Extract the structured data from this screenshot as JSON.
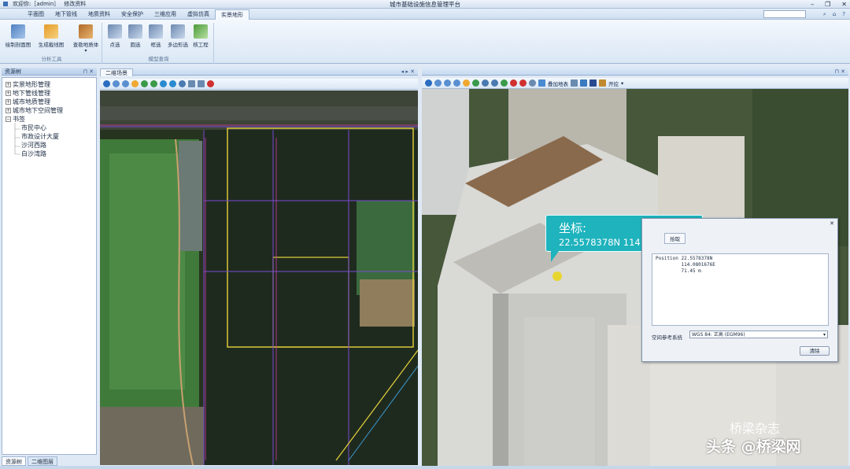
{
  "window": {
    "welcome": "欢迎你:［admin］",
    "switch_label": "修改资料",
    "title": "城市基础设施信息管理平台"
  },
  "ribbon": {
    "tabs": [
      "平面图",
      "地下管线",
      "地质资料",
      "安全保护",
      "三维应用",
      "虚拟仿真",
      "实景地形"
    ],
    "active_tab": "实景地形",
    "groups": [
      {
        "label": "分析工具",
        "buttons": [
          "绘制剖面图",
          "生成截线图",
          "查勘地质体"
        ]
      },
      {
        "label": "模型查询",
        "buttons": [
          "点选",
          "圆选",
          "框选",
          "多边形选",
          "核工程"
        ]
      }
    ]
  },
  "left_panel": {
    "title": "资源树",
    "tree": [
      {
        "label": "实景地形管理",
        "level": 0,
        "expandable": true
      },
      {
        "label": "地下管线管理",
        "level": 0,
        "expandable": true
      },
      {
        "label": "城市地质管理",
        "level": 0,
        "expandable": true
      },
      {
        "label": "城市地下空间管理",
        "level": 0,
        "expandable": true
      },
      {
        "label": "书签",
        "level": 0,
        "expandable": true,
        "expanded": true
      },
      {
        "label": "市民中心",
        "level": 1
      },
      {
        "label": "市政设计大厦",
        "level": 1
      },
      {
        "label": "沙河西路",
        "level": 1
      },
      {
        "label": "白沙湾路",
        "level": 1
      }
    ],
    "bottom_tabs": [
      "资源树",
      "二维图层"
    ],
    "active_bottom_tab": "资源树"
  },
  "map2d": {
    "tab_label": "二维场景"
  },
  "map3d": {
    "toolbar_overlay_label": "叠加地表",
    "toolbar_open_label": "开挖",
    "callout": {
      "label": "坐标:",
      "value": "22.5578378N  114.0802402E"
    },
    "dialog": {
      "tab_label": "拾取",
      "lines": [
        "Position 22.5578378N",
        "         114.0801676E",
        "         71.45 m"
      ],
      "srs_label": "空间参考系统",
      "srs_value": "WGS 84: 正高 (EGM96)",
      "clear_label": "清除"
    }
  },
  "watermark": {
    "line1": "桥梁杂志",
    "line2": "头条 @桥梁网"
  },
  "colors": {
    "accent": "#1eb3bd",
    "ribbon_bg": "#dae7f5"
  }
}
